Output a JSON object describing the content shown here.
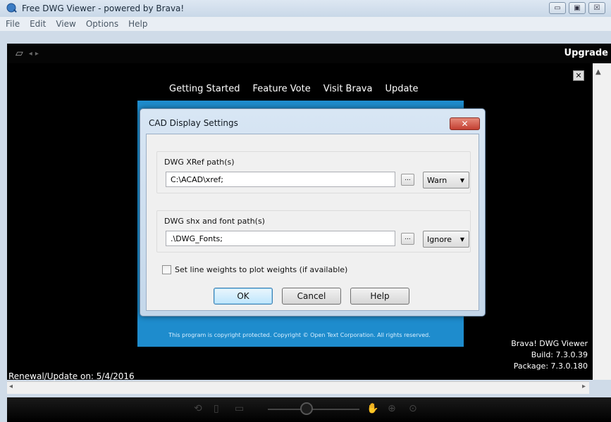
{
  "window": {
    "title": "Free DWG Viewer - powered by Brava!",
    "controls": {
      "minimize": "▭",
      "maximize": "▣",
      "close": "☒"
    }
  },
  "menu": [
    "File",
    "Edit",
    "View",
    "Options",
    "Help"
  ],
  "toolbar": {
    "upgrade_label": "Upgrade"
  },
  "viewer": {
    "nav_links": [
      "Getting Started",
      "Feature Vote",
      "Visit Brava",
      "Update"
    ],
    "copyright": "This program is copyright protected. Copyright © Open Text Corporation. All rights reserved.",
    "renewal": "Renewal/Update on: 5/4/2016",
    "product": "Brava! DWG Viewer",
    "build": "Build: 7.3.0.39",
    "package": "Package: 7.3.0.180",
    "close_box": "✕"
  },
  "dialog": {
    "title": "CAD Display Settings",
    "close_label": "✕",
    "xref": {
      "label": "DWG XRef path(s)",
      "value": "C:\\ACAD\\xref;",
      "browse": "...",
      "option": "Warn"
    },
    "fonts": {
      "label": "DWG shx and font path(s)",
      "value": ".\\DWG_Fonts;",
      "browse": "...",
      "option": "Ignore"
    },
    "checkbox": {
      "label": "Set line weights to plot weights (if available)",
      "checked": false
    },
    "buttons": {
      "ok": "OK",
      "cancel": "Cancel",
      "help": "Help"
    }
  },
  "icons": {
    "open": "▱",
    "back": "◂",
    "forward": "▸",
    "scroll_up": "▲",
    "scroll_left": "◂",
    "scroll_right": "▸",
    "dropdown": "▼"
  }
}
